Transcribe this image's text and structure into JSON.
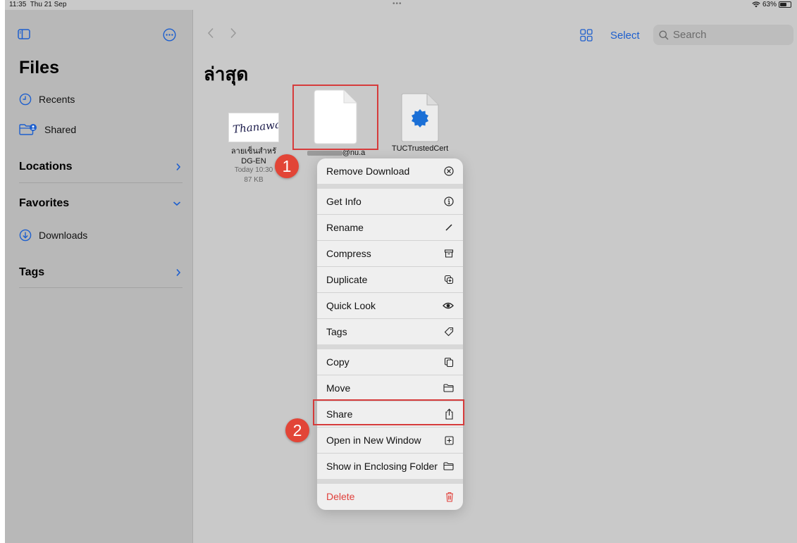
{
  "status": {
    "time": "11:35",
    "date": "Thu 21 Sep",
    "dots": "•••",
    "battery": "63%",
    "battery_level": 0.63
  },
  "sidebar": {
    "title": "Files",
    "recents": "Recents",
    "shared": "Shared",
    "locations": "Locations",
    "favorites": "Favorites",
    "downloads": "Downloads",
    "tags": "Tags"
  },
  "toolbar": {
    "select": "Select",
    "search_placeholder": "Search"
  },
  "main": {
    "title": "ล่าสุด"
  },
  "files": [
    {
      "name": "ลายเซ็นสําหรั",
      "name2": "DG-EN",
      "date": "Today 10:30",
      "size": "87 KB",
      "thumb_text": "Thanawal"
    },
    {
      "name": "@nu.a"
    },
    {
      "name": "TUCTrustedCert"
    }
  ],
  "menu": {
    "items": [
      {
        "label": "Remove Download",
        "icon": "x-circle-icon"
      },
      {
        "label": "Get Info",
        "icon": "info-icon"
      },
      {
        "label": "Rename",
        "icon": "pencil-icon"
      },
      {
        "label": "Compress",
        "icon": "archivebox-icon"
      },
      {
        "label": "Duplicate",
        "icon": "duplicate-icon"
      },
      {
        "label": "Quick Look",
        "icon": "eye-icon"
      },
      {
        "label": "Tags",
        "icon": "tag-icon"
      },
      {
        "label": "Copy",
        "icon": "copy-icon"
      },
      {
        "label": "Move",
        "icon": "folder-icon"
      },
      {
        "label": "Share",
        "icon": "share-icon"
      },
      {
        "label": "Open in New Window",
        "icon": "plus-square-icon"
      },
      {
        "label": "Show in Enclosing Folder",
        "icon": "folder-icon"
      },
      {
        "label": "Delete",
        "icon": "trash-icon"
      }
    ]
  },
  "annotations": {
    "step1": "1",
    "step2": "2"
  },
  "colors": {
    "accent": "#1d5fce",
    "danger": "#e0403b",
    "annotation": "#e24537"
  }
}
